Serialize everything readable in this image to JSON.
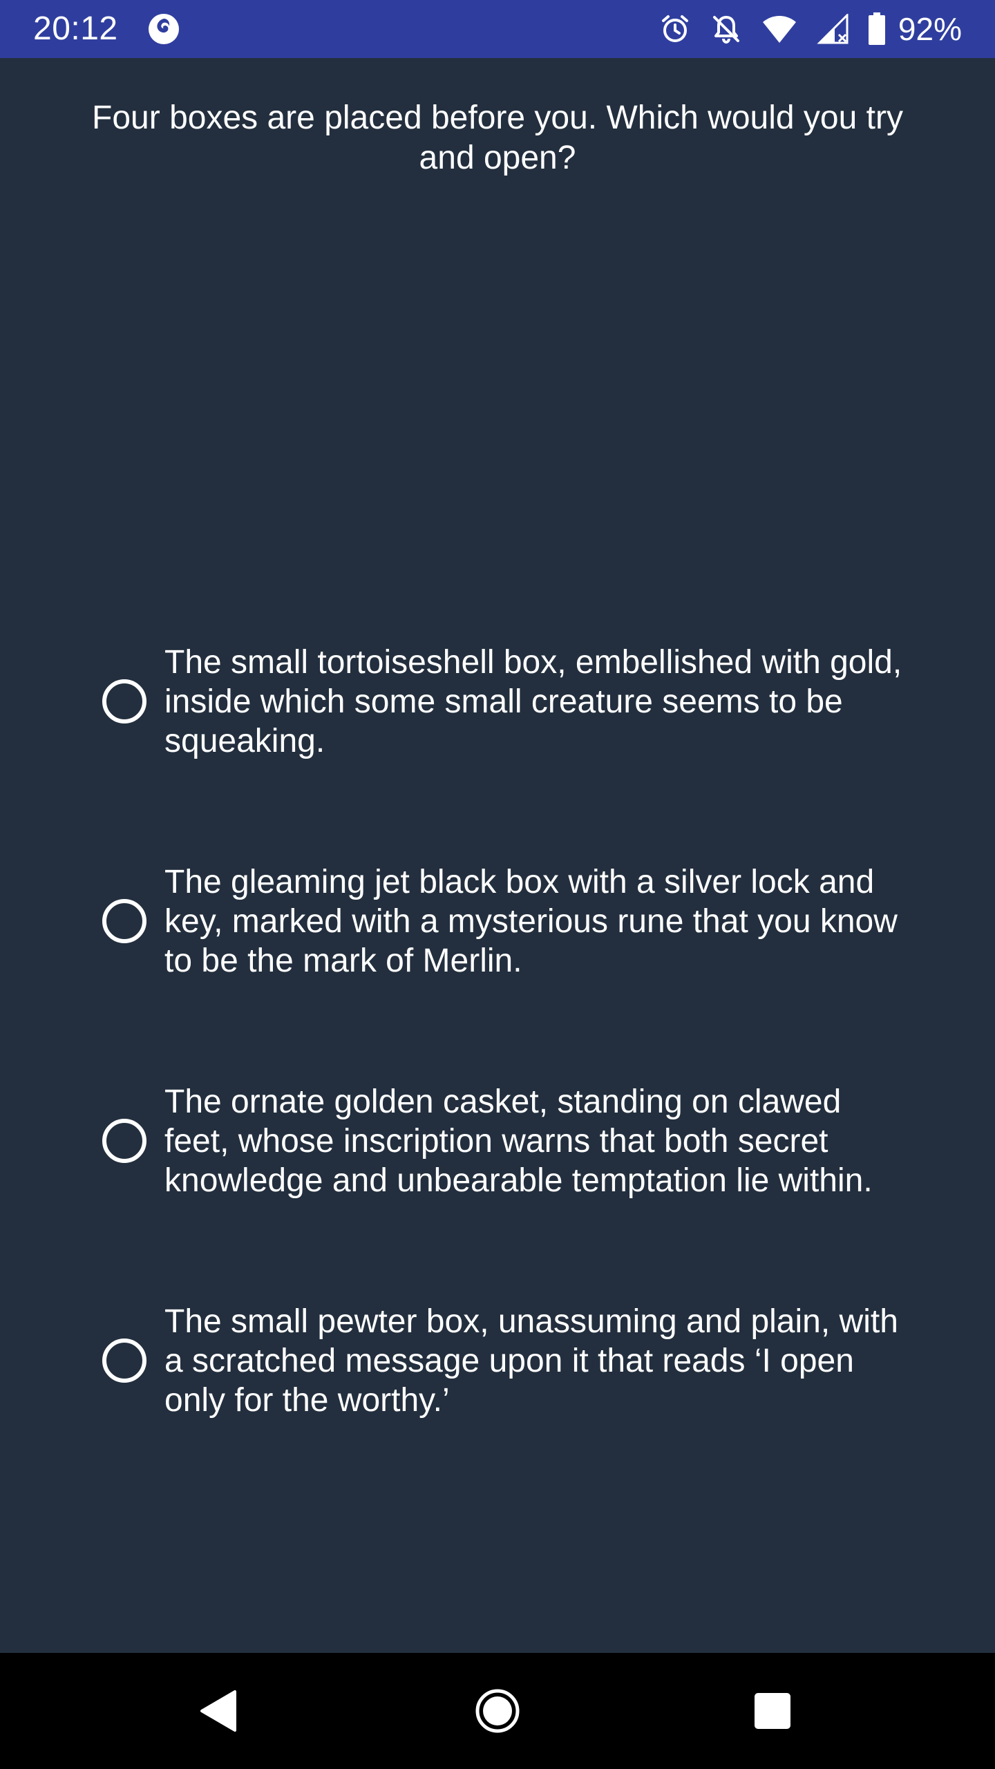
{
  "status_bar": {
    "time": "20:12",
    "battery": "92%",
    "icons": [
      "firefox-icon",
      "alarm-icon",
      "notifications-off-icon",
      "wifi-icon",
      "cell-signal-icon",
      "battery-icon"
    ]
  },
  "question": "Four boxes are placed before you. Which would you try and open?",
  "options": [
    {
      "label": "The small tortoiseshell box, embellished with gold, inside which some small creature seems to be squeaking.",
      "selected": false
    },
    {
      "label": "The gleaming jet black box with a silver lock and key, marked with a mysterious rune that you know to be the mark of Merlin.",
      "selected": false
    },
    {
      "label": "The ornate golden casket, standing on clawed feet, whose inscription warns that both secret knowledge and unbearable temptation lie within.",
      "selected": false
    },
    {
      "label": "The small pewter box, unassuming and plain, with a scratched message upon it that reads ‘I open only for the worthy.’",
      "selected": false
    }
  ],
  "nav_bar": {
    "icons": [
      "back-icon",
      "home-icon",
      "recents-icon"
    ]
  },
  "colors": {
    "status_bar": "#2f3e9e",
    "background": "#232f3e",
    "nav_bar": "#000000",
    "text": "#ffffff"
  }
}
